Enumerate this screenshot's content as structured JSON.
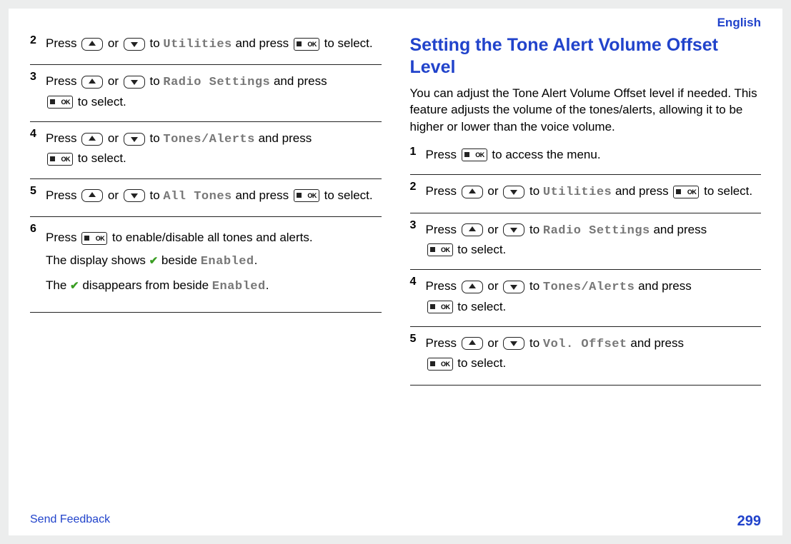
{
  "header": {
    "language": "English"
  },
  "left": {
    "steps": [
      {
        "num": "2",
        "prefix": "Press ",
        "mid": " or ",
        "to": " to ",
        "target": "Utilities",
        "after": " and press ",
        "tail": " to select."
      },
      {
        "num": "3",
        "prefix": "Press ",
        "mid": " or ",
        "to": " to ",
        "target": "Radio Settings",
        "after": " and press ",
        "tail": " to select."
      },
      {
        "num": "4",
        "prefix": "Press ",
        "mid": " or ",
        "to": " to ",
        "target": "Tones/Alerts",
        "after": " and press ",
        "tail": " to select."
      },
      {
        "num": "5",
        "prefix": "Press ",
        "mid": " or ",
        "to": " to ",
        "target": "All Tones",
        "after": " and press ",
        "tail": " to select."
      },
      {
        "num": "6",
        "line1a": "Press ",
        "line1b": " to enable/disable all tones and alerts.",
        "line2a": "The display shows ",
        "line2b": " beside ",
        "line2_target": "Enabled",
        "line2c": ".",
        "line3a": "The ",
        "line3b": " disappears from beside ",
        "line3_target": "Enabled",
        "line3c": "."
      }
    ]
  },
  "right": {
    "title": "Setting the Tone Alert Volume Offset Level",
    "intro": "You can adjust the Tone Alert Volume Offset level if needed. This feature adjusts the volume of the tones/alerts, allowing it to be higher or lower than the voice volume.",
    "steps": [
      {
        "num": "1",
        "prefix": "Press ",
        "after": " to access the menu."
      },
      {
        "num": "2",
        "prefix": "Press ",
        "mid": " or ",
        "to": " to ",
        "target": "Utilities",
        "after": " and press ",
        "tail": " to select."
      },
      {
        "num": "3",
        "prefix": "Press ",
        "mid": " or ",
        "to": " to ",
        "target": "Radio Settings",
        "after": " and press ",
        "tail": " to select."
      },
      {
        "num": "4",
        "prefix": "Press ",
        "mid": " or ",
        "to": " to ",
        "target": "Tones/Alerts",
        "after": " and press ",
        "tail": " to select."
      },
      {
        "num": "5",
        "prefix": "Press ",
        "mid": " or ",
        "to": " to ",
        "target": "Vol. Offset",
        "after": " and press ",
        "tail": " to select."
      }
    ]
  },
  "footer": {
    "link": "Send Feedback",
    "page": "299"
  }
}
